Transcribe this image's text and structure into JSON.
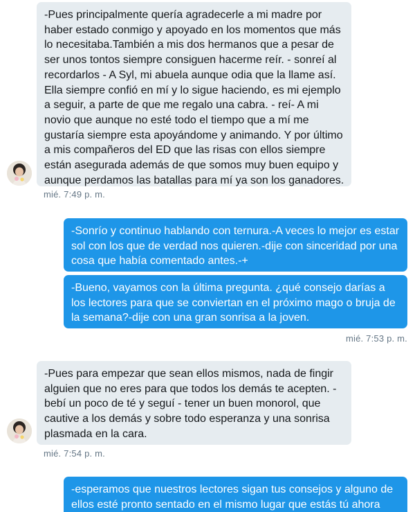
{
  "messages": [
    {
      "direction": "incoming",
      "text": "-Pues principalmente quería agradecerle a mi madre por haber estado conmigo y apoyado en los momentos que más lo necesitaba.También a mis dos hermanos que a pesar de ser unos tontos siempre consiguen hacerme reír. - sonreí al recordarlos - A Syl, mi abuela aunque odia que la llame así. Ella siempre confió en mí y lo sigue haciendo, es mi ejemplo a seguir, a parte de que me regalo una cabra. - reí-  A mi novio que aunque no esté todo el tiempo que a mí me gustaría siempre esta apoyándome y animando. Y por último a mis compañeros del ED que las risas con ellos siempre están asegurada además de que somos muy buen equipo y aunque perdamos las batallas para mí ya son los ganadores."
    },
    {
      "direction": "outgoing",
      "text": "-Sonrío y continuo hablando con ternura.-A veces lo mejor es estar sol con los que de verdad nos quieren.-dije con sinceridad por una cosa que había comentado antes.-+"
    },
    {
      "direction": "outgoing",
      "text": "-Bueno, vayamos con la última pregunta. ¿qué consejo darías a los lectores para que se conviertan en el próximo mago o bruja de la semana?-dije con una gran sonrisa a la joven."
    },
    {
      "direction": "incoming",
      "text": "-Pues para empezar que sean ellos mismos, nada de fingir alguien que no eres para que todos los demás te acepten. -bebí un poco de té y seguí - tener un buen monorol, que cautive a los demás y sobre todo esperanza y una sonrisa plasmada en la cara."
    },
    {
      "direction": "outgoing",
      "text": "-esperamos que nuestros lectores sigan tus consejos y alguno de ellos esté pronto sentado en el mismo lugar que estás tú ahora"
    }
  ],
  "timestamps": [
    "mié. 7:49 p. m.",
    "mié. 7:53 p. m.",
    "mié. 7:54 p. m."
  ],
  "colors": {
    "incoming_bubble": "#e6ecf0",
    "outgoing_bubble": "#1e96e8",
    "timestamp": "#657786"
  },
  "icons": [
    "avatar-photo"
  ]
}
